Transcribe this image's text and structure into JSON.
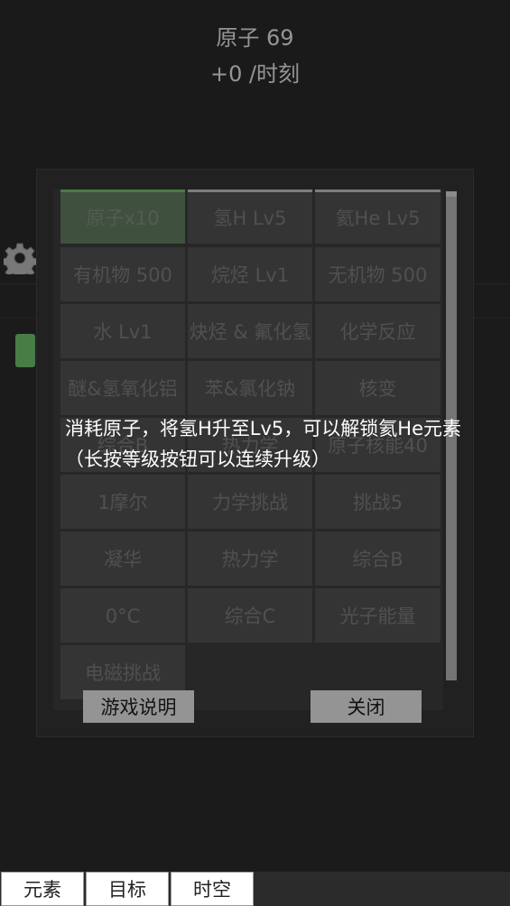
{
  "header": {
    "atoms_label": "原子 69",
    "rate_label": "+0 /时刻"
  },
  "grid": {
    "cells": [
      "原子x10",
      "氢H Lv5",
      "氦He Lv5",
      "有机物 500",
      "烷烃 Lv1",
      "无机物 500",
      "水 Lv1",
      "炔烃 & 氟化氢",
      "化学反应",
      "醚&氢氧化铝",
      "苯&氯化钠",
      "核变",
      "综合B",
      "热力学",
      "原子核能40",
      "1摩尔",
      "力学挑战",
      "挑战5",
      "凝华",
      "热力学",
      "综合B",
      "0°C",
      "综合C",
      "光子能量",
      "电磁挑战"
    ]
  },
  "modal": {
    "help_button": "游戏说明",
    "close_button": "关闭"
  },
  "tooltip": {
    "text": "消耗原子，将氢H升至Lv5，可以解锁氦He元素（长按等级按钮可以连续升级）"
  },
  "tabs": [
    "元素",
    "目标",
    "时空"
  ],
  "colors": {
    "accent_green": "#7bd47b",
    "background": "#303030"
  }
}
